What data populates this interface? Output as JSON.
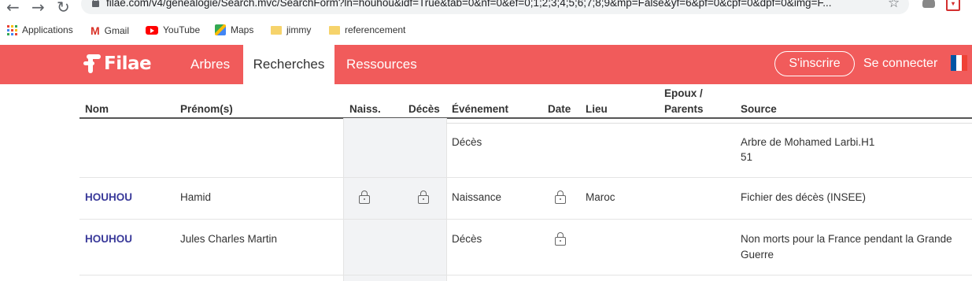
{
  "browser": {
    "url": "filae.com/v4/genealogie/Search.mvc/SearchForm?ln=houhou&idf=True&tab=0&nf=0&ef=0;1;2;3;4;5;6;7;8;9&mp=False&yf=6&pf=0&cpf=0&dpf=0&img=F...",
    "bookmarks": [
      "Applications",
      "Gmail",
      "YouTube",
      "Maps",
      "jimmy",
      "referencement"
    ]
  },
  "nav": {
    "logo": "Filae",
    "links": [
      "Arbres",
      "Recherches",
      "Ressources"
    ],
    "active_index": 1,
    "signup": "S'inscrire",
    "login": "Se connecter"
  },
  "table": {
    "headers": {
      "nom": "Nom",
      "prenom": "Prénom(s)",
      "naiss": "Naiss.",
      "deces": "Décès",
      "evenement": "Événement",
      "date": "Date",
      "lieu": "Lieu",
      "epoux_1": "Epoux /",
      "epoux_2": "Parents",
      "source": "Source"
    },
    "rows": [
      {
        "nom": "",
        "prenom": "",
        "evenement": "Décès",
        "lieu": "",
        "source_1": "Arbre de Mohamed Larbi.H1",
        "source_2": "51"
      },
      {
        "nom": "HOUHOU",
        "prenom": "Hamid",
        "evenement": "Naissance",
        "lieu": "Maroc",
        "source_1": "Fichier des décès (INSEE)",
        "source_2": ""
      },
      {
        "nom": "HOUHOU",
        "prenom": "Jules Charles Martin",
        "evenement": "Décès",
        "lieu": "",
        "source_1": "Non morts pour la France pendant la Grande",
        "source_2": "Guerre"
      }
    ]
  },
  "colors": {
    "brand": "#f15b5b",
    "name_link": "#3a3a9a"
  }
}
